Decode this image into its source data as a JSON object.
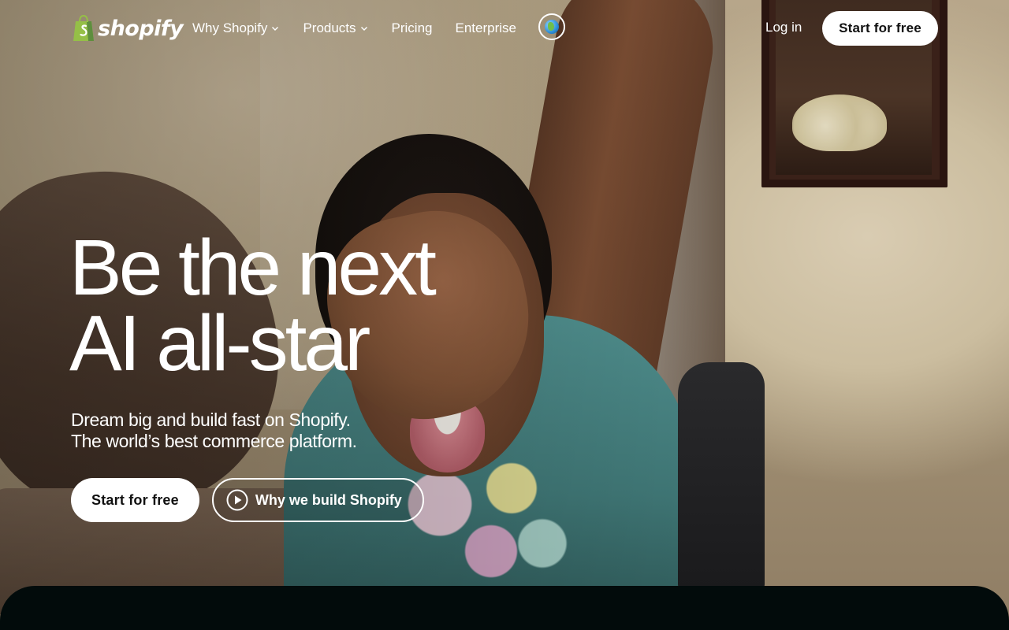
{
  "brand": {
    "name": "shopify",
    "bag_color": "#95bf47",
    "bag_dark": "#5e8e3e"
  },
  "nav": {
    "items": [
      {
        "label": "Why Shopify",
        "has_dropdown": true
      },
      {
        "label": "Products",
        "has_dropdown": true
      },
      {
        "label": "Pricing",
        "has_dropdown": false
      },
      {
        "label": "Enterprise",
        "has_dropdown": false
      }
    ],
    "globe_icon": "globe-icon",
    "login_label": "Log in",
    "cta_label": "Start for free"
  },
  "hero": {
    "title_lines": [
      "Be the next",
      "AI all-star"
    ],
    "subtitle_lines": [
      "Dream big and build fast on Shopify.",
      "The world’s best commerce platform."
    ],
    "primary_cta": "Start for free",
    "secondary_cta": "Why we build Shopify",
    "secondary_icon": "play-circle-icon"
  },
  "colors": {
    "text_on_hero": "#ffffff",
    "button_bg": "#ffffff",
    "button_text": "#111111",
    "dark_band": "#020b0b"
  }
}
